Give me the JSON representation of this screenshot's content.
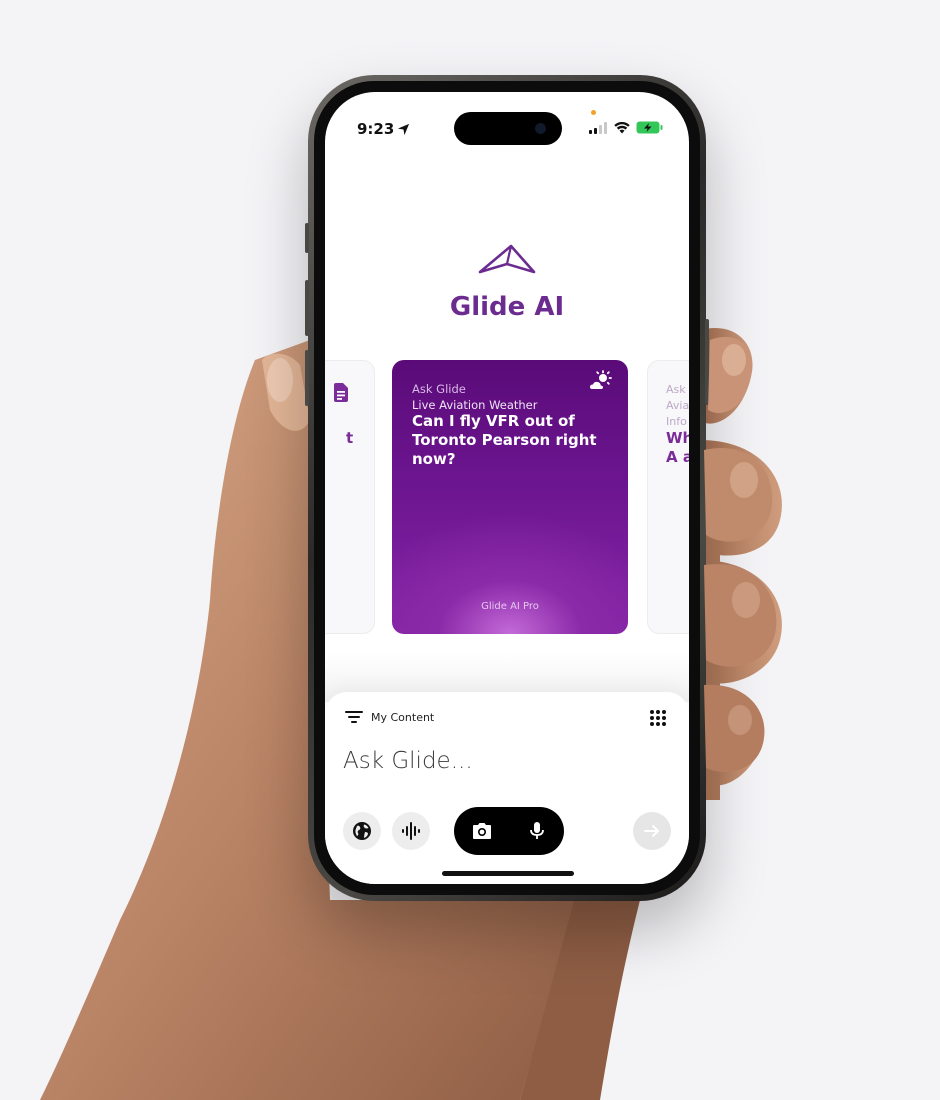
{
  "status_bar": {
    "time": "9:23",
    "icons": [
      "location-arrow-icon",
      "cellular-signal-icon",
      "wifi-icon",
      "battery-charging-icon"
    ]
  },
  "app": {
    "title": "Glide AI",
    "logo_icon": "glide-logo-icon",
    "brand_color": "#6b2b8f"
  },
  "cards": {
    "left": {
      "icon": "document-icon",
      "fragment": "t"
    },
    "main": {
      "kicker": "Ask Glide",
      "category": "Live Aviation Weather",
      "question": "Can I fly VFR out of Toronto Pearson right now?",
      "badge_icon": "weather-sun-cloud-icon",
      "footer": "Glide AI Pro"
    },
    "right": {
      "kicker": "Ask",
      "line1": "Avia",
      "line2": "Info",
      "q1": "Wh",
      "q2": "A a"
    }
  },
  "composer": {
    "filter_label": "My Content",
    "placeholder": "Ask Glide...",
    "buttons": {
      "globe": "globe-icon",
      "voice": "voice-waveform-icon",
      "camera": "camera-icon",
      "mic": "microphone-icon",
      "send": "arrow-right-icon",
      "grid": "grid-dots-icon",
      "filter": "filter-lines-icon"
    }
  }
}
